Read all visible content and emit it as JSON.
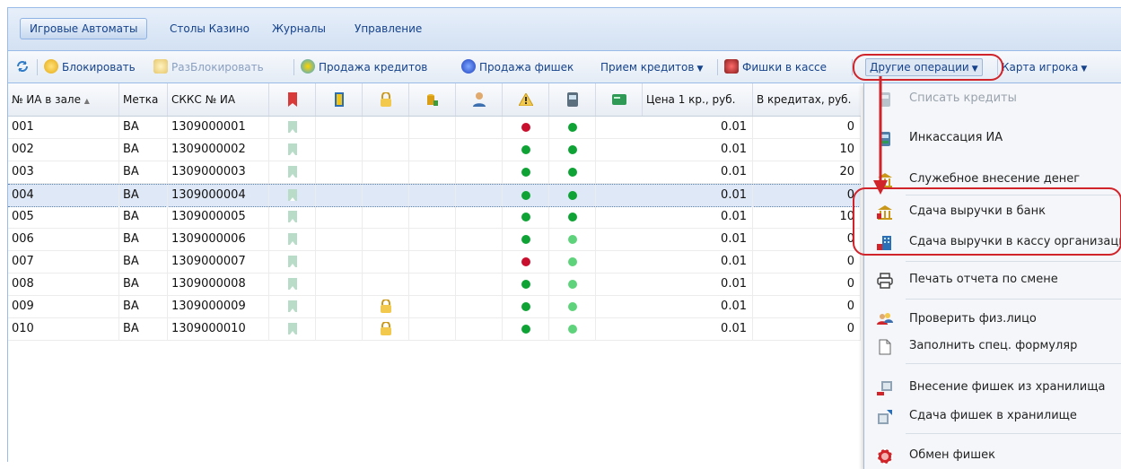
{
  "tabs": [
    "Игровые Автоматы",
    "Столы Казино",
    "Журналы",
    "Управление"
  ],
  "toolbar": {
    "block": "Блокировать",
    "unblock": "РазБлокировать",
    "sell_credits": "Продажа кредитов",
    "sell_chips": "Продажа фишек",
    "receive_credits": "Прием кредитов",
    "chips_in_cash": "Фишки в кассе",
    "other_ops": "Другие операции",
    "player_card": "Карта игрока"
  },
  "columns": {
    "slot_no": "№ ИА в зале",
    "mark": "Метка",
    "skks": "СККС № ИА",
    "price": "Цена 1 кр., руб.",
    "in_credits": "В кредитах, руб."
  },
  "rows": [
    {
      "no": "001",
      "mark": "ВА",
      "skks": "1309000001",
      "lock": false,
      "s1": "red",
      "s2": "green",
      "price": "0.01",
      "credits": "0"
    },
    {
      "no": "002",
      "mark": "ВА",
      "skks": "1309000002",
      "lock": false,
      "s1": "green",
      "s2": "green",
      "price": "0.01",
      "credits": "10"
    },
    {
      "no": "003",
      "mark": "ВА",
      "skks": "1309000003",
      "lock": false,
      "s1": "green",
      "s2": "green",
      "price": "0.01",
      "credits": "20"
    },
    {
      "no": "004",
      "mark": "ВА",
      "skks": "1309000004",
      "lock": false,
      "s1": "green",
      "s2": "green",
      "price": "0.01",
      "credits": "0"
    },
    {
      "no": "005",
      "mark": "ВА",
      "skks": "1309000005",
      "lock": false,
      "s1": "green",
      "s2": "green",
      "price": "0.01",
      "credits": "10"
    },
    {
      "no": "006",
      "mark": "ВА",
      "skks": "1309000006",
      "lock": false,
      "s1": "green",
      "s2": "lightgreen",
      "price": "0.01",
      "credits": "0"
    },
    {
      "no": "007",
      "mark": "ВА",
      "skks": "1309000007",
      "lock": false,
      "s1": "red",
      "s2": "lightgreen",
      "price": "0.01",
      "credits": "0"
    },
    {
      "no": "008",
      "mark": "ВА",
      "skks": "1309000008",
      "lock": false,
      "s1": "green",
      "s2": "lightgreen",
      "price": "0.01",
      "credits": "0"
    },
    {
      "no": "009",
      "mark": "ВА",
      "skks": "1309000009",
      "lock": true,
      "s1": "green",
      "s2": "lightgreen",
      "price": "0.01",
      "credits": "0"
    },
    {
      "no": "010",
      "mark": "ВА",
      "skks": "1309000010",
      "lock": true,
      "s1": "green",
      "s2": "lightgreen",
      "price": "0.01",
      "credits": "0"
    }
  ],
  "selected_row": "004",
  "menu": {
    "write_off": "Списать кредиты",
    "collection": "Инкассация ИА",
    "service_deposit": "Служебное внесение денег",
    "to_bank": "Сдача выручки в банк",
    "to_org_cash": "Сдача выручки в кассу организации",
    "print_report": "Печать отчета по смене",
    "check_person": "Проверить физ.лицо",
    "fill_form": "Заполнить спец. формуляр",
    "chips_from_vault": "Внесение фишек из хранилища",
    "chips_to_vault": "Сдача фишек в хранилище",
    "chip_exchange": "Обмен фишек"
  },
  "colors": {
    "status_red": "#c8102e",
    "status_green": "#0fa336",
    "status_lightgreen": "#5fd37b",
    "annotation_red": "#d0232a"
  }
}
